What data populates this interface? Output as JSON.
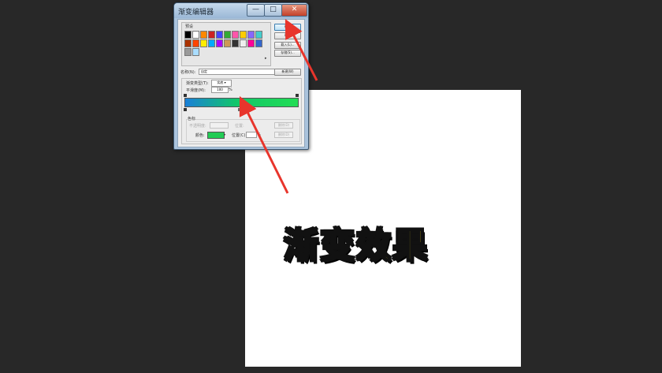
{
  "caption": "渐变效果",
  "dialog": {
    "title": "渐变编辑器",
    "window_controls": {
      "minimize": "—",
      "maximize": "□",
      "close": "✕"
    },
    "presets_label": "预设",
    "buttons": {
      "ok": "确定",
      "cancel": "取消",
      "load": "载入(L)...",
      "save": "存储(S)..."
    },
    "name_label": "名称(N):",
    "name_value": "自定",
    "new_button": "新建(W)",
    "gradient_type_label": "渐变类型(T):",
    "gradient_type_value": "实底",
    "smoothness_label": "平滑度(M):",
    "smoothness_value": "100",
    "smoothness_unit": "%",
    "stops_group_label": "色标",
    "opacity_label": "不透明度:",
    "opacity_location_label": "位置:",
    "delete_label": "删除(D)",
    "color_label": "颜色:",
    "location_label": "位置(C):",
    "location_unit": "%",
    "colors": {
      "gradient_start": "#1a7fd8",
      "gradient_end": "#22dd55",
      "stop_color": "#22cc55"
    }
  },
  "colors": {
    "workspace": "#282828",
    "caption_fill": "#ffe21a",
    "arrow": "#e8352c"
  },
  "swatches": [
    "#000000",
    "#ffffff",
    "#ff8800",
    "#cc2222",
    "#4444ff",
    "#33aa33",
    "#ff55aa",
    "#ffcc00",
    "#8866ff",
    "#44cccc",
    "#aa3300",
    "#ff4400",
    "#ffee00",
    "#00aaff",
    "#aa00ff",
    "#cc9955",
    "#333333",
    "#eeeeee",
    "#ff0099",
    "#3366cc",
    "#999999",
    "#aaddff"
  ]
}
